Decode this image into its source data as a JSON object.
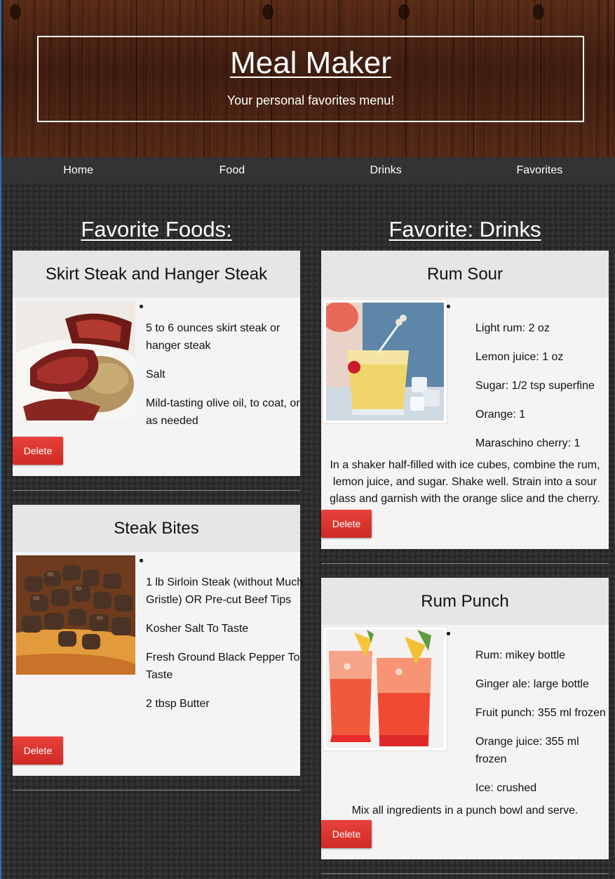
{
  "header": {
    "title": "Meal Maker",
    "subtitle": "Your personal favorites menu!"
  },
  "nav": {
    "items": [
      {
        "label": "Home"
      },
      {
        "label": "Food"
      },
      {
        "label": "Drinks"
      },
      {
        "label": "Favorites"
      }
    ]
  },
  "foods": {
    "heading": "Favorite Foods:",
    "cards": [
      {
        "title": "Skirt Steak and Hanger Steak",
        "ingredients": [
          "5 to 6 ounces skirt steak or hanger steak",
          "Salt",
          "Mild-tasting olive oil, to coat, or as needed"
        ],
        "delete_label": "Delete"
      },
      {
        "title": "Steak Bites",
        "ingredients": [
          "1 lb Sirloin Steak (without Much Gristle) OR Pre-cut Beef Tips",
          "Kosher Salt To Taste",
          "Fresh Ground Black Pepper To Taste",
          "2 tbsp Butter"
        ],
        "delete_label": "Delete"
      }
    ]
  },
  "drinks": {
    "heading": "Favorite: Drinks",
    "cards": [
      {
        "title": "Rum Sour",
        "ingredients": [
          "Light rum: 2 oz",
          "Lemon juice: 1 oz",
          "Sugar: 1/2 tsp superfine",
          "Orange: 1",
          "Maraschino cherry: 1"
        ],
        "instructions": "In a shaker half-filled with ice cubes, combine the rum, lemon juice, and sugar. Shake well. Strain into a sour glass and garnish with the orange slice and the cherry.",
        "delete_label": "Delete"
      },
      {
        "title": "Rum Punch",
        "ingredients": [
          "Rum: mikey bottle",
          "Ginger ale: large bottle",
          "Fruit punch: 355 ml frozen",
          "Orange juice: 355 ml frozen",
          "Ice: crushed"
        ],
        "instructions": "Mix all ingredients in a punch bowl and serve.",
        "delete_label": "Delete"
      }
    ]
  },
  "colors": {
    "nav_bg": "#333333",
    "card_bg": "#f4f4f4",
    "card_header_bg": "#e6e6e6",
    "delete_button": "#d8302a"
  }
}
